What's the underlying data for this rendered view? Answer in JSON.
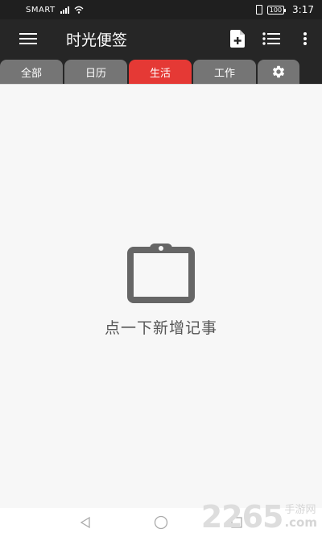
{
  "status_bar": {
    "carrier": "SMART",
    "battery": "100",
    "time": "3:17"
  },
  "app_bar": {
    "title": "时光便签",
    "icons": [
      "menu-icon",
      "new-note-icon",
      "list-icon",
      "more-icon"
    ]
  },
  "tabs": [
    {
      "label": "全部",
      "active": false
    },
    {
      "label": "日历",
      "active": false
    },
    {
      "label": "生活",
      "active": true
    },
    {
      "label": "工作",
      "active": false
    }
  ],
  "empty_state": {
    "icon": "clipboard-icon",
    "text": "点一下新增记事"
  },
  "nav_bar": {
    "icons": [
      "back-icon",
      "home-icon",
      "recents-icon"
    ]
  },
  "watermark": {
    "number": "2265",
    "cn": "手游网",
    "suffix": ".com"
  },
  "colors": {
    "accent": "#e53935",
    "toolbar": "#262626",
    "tab_inactive": "#757575",
    "background": "#f7f7f7"
  }
}
